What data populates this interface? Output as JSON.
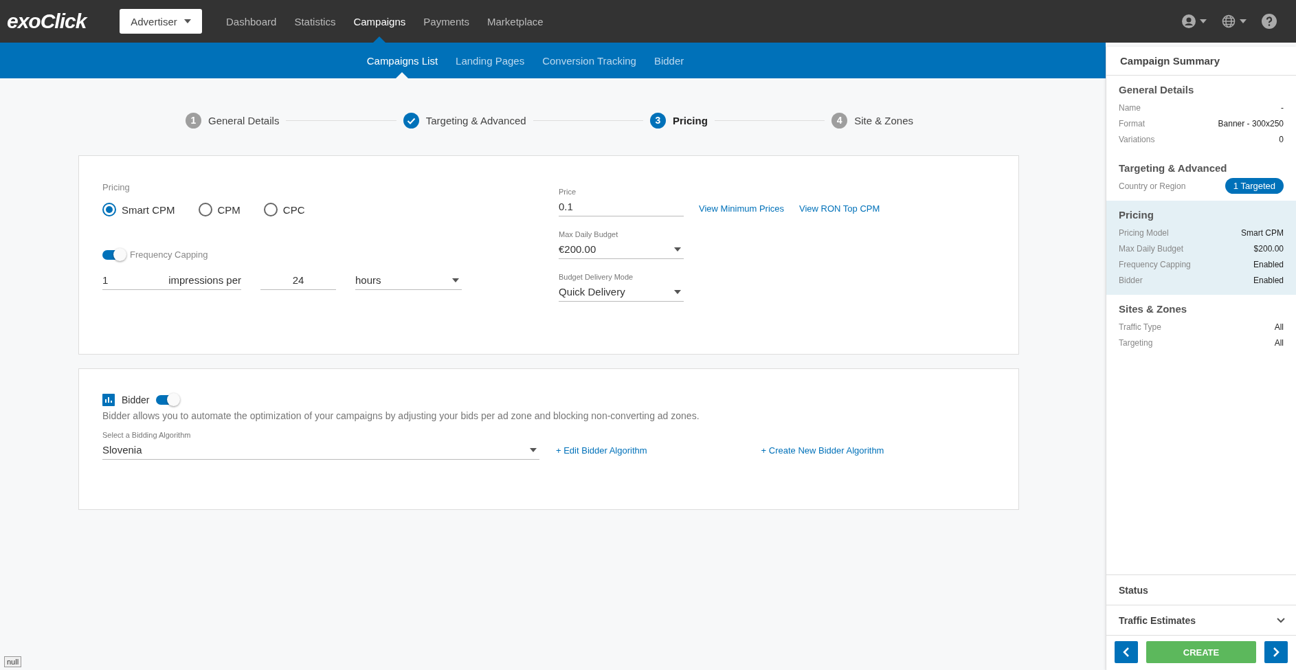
{
  "top_nav": {
    "logo": "exoClick",
    "account_dropdown": "Advertiser",
    "items": [
      {
        "label": "Dashboard",
        "selected": false
      },
      {
        "label": "Statistics",
        "selected": false
      },
      {
        "label": "Campaigns",
        "selected": true
      },
      {
        "label": "Payments",
        "selected": false
      },
      {
        "label": "Marketplace",
        "selected": false
      }
    ]
  },
  "sub_nav": {
    "items": [
      {
        "label": "Campaigns List",
        "selected": true
      },
      {
        "label": "Landing Pages",
        "selected": false
      },
      {
        "label": "Conversion Tracking",
        "selected": false
      },
      {
        "label": "Bidder",
        "selected": false
      }
    ]
  },
  "steps": [
    {
      "number": "1",
      "label": "General Details",
      "completed": false,
      "selected": false
    },
    {
      "label": "Targeting & Advanced",
      "completed": true,
      "selected": false
    },
    {
      "number": "3",
      "label": "Pricing",
      "completed": false,
      "selected": true
    },
    {
      "number": "4",
      "label": "Site & Zones",
      "completed": false,
      "selected": false
    }
  ],
  "pricing_card": {
    "pricing_label": "Pricing",
    "options": [
      {
        "label": "Smart CPM",
        "selected": true
      },
      {
        "label": "CPM",
        "selected": false
      },
      {
        "label": "CPC",
        "selected": false
      }
    ],
    "frequency_capping": {
      "label": "Frequency Capping",
      "on": true,
      "impressions": "1",
      "impressions_label": "impressions per",
      "period": "24",
      "unit": "hours"
    },
    "price": {
      "label": "Price",
      "value": "0.1"
    },
    "links": [
      "View Minimum Prices",
      "View RON Top CPM"
    ],
    "max_daily_budget": {
      "label": "Max Daily Budget",
      "value": "€200.00"
    },
    "delivery_mode": {
      "label": "Budget Delivery Mode",
      "value": "Quick Delivery"
    }
  },
  "bidder_card": {
    "title": "Bidder",
    "on": true,
    "description": "Bidder allows you to automate the optimization of your campaigns by adjusting your bids per ad zone and blocking non-converting ad zones.",
    "algorithm": {
      "label": "Select a Bidding Algorithm",
      "value": "Slovenia"
    },
    "links": [
      "+ Edit Bidder Algorithm",
      "+ Create New Bidder Algorithm"
    ]
  },
  "summary": {
    "title": "Campaign Summary",
    "sections": [
      {
        "title": "General Details",
        "highlighted": false,
        "rows": [
          {
            "label": "Name",
            "value": "-",
            "kind": "text"
          },
          {
            "label": "Format",
            "value": "Banner - 300x250",
            "kind": "text"
          },
          {
            "label": "Variations",
            "value": "0",
            "kind": "text"
          }
        ]
      },
      {
        "title": "Targeting & Advanced",
        "highlighted": false,
        "rows": [
          {
            "label": "Country or Region",
            "value": "1 Targeted",
            "kind": "badge"
          }
        ]
      },
      {
        "title": "Pricing",
        "highlighted": true,
        "rows": [
          {
            "label": "Pricing Model",
            "value": "Smart CPM",
            "kind": "text"
          },
          {
            "label": "Max Daily Budget",
            "value": "$200.00",
            "kind": "text"
          },
          {
            "label": "Frequency Capping",
            "value": "Enabled",
            "kind": "text"
          },
          {
            "label": "Bidder",
            "value": "Enabled",
            "kind": "text"
          }
        ]
      },
      {
        "title": "Sites & Zones",
        "highlighted": false,
        "rows": [
          {
            "label": "Traffic Type",
            "value": "All",
            "kind": "text"
          },
          {
            "label": "Targeting",
            "value": "All",
            "kind": "text"
          }
        ]
      }
    ],
    "panels": [
      {
        "title": "Status",
        "expandable": false
      },
      {
        "title": "Traffic Estimates",
        "expandable": true
      }
    ],
    "create_button": "CREATE"
  },
  "debug_tag": "null"
}
